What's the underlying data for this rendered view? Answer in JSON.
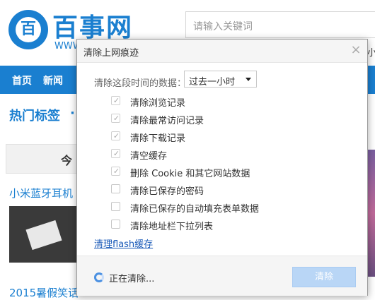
{
  "background": {
    "logo_mark": "百",
    "logo_text": "百事网",
    "logo_www": "WWW",
    "search_placeholder": "请输入关键词",
    "right_fragment": "小",
    "nav": [
      "首页",
      "新闻"
    ],
    "hot_tags": "热门标签",
    "hot_dot": "·",
    "today": "今",
    "article_title": "小米蓝牙耳机",
    "bottom_title": "2015暑假笑话"
  },
  "dialog": {
    "title": "清除上网痕迹",
    "close_icon": "×",
    "time_label": "清除这段时间的数据：",
    "time_value": "过去一小时",
    "options": [
      {
        "label": "清除浏览记录",
        "checked": true
      },
      {
        "label": "清除最常访问记录",
        "checked": true
      },
      {
        "label": "清除下载记录",
        "checked": true
      },
      {
        "label": "清空缓存",
        "checked": true
      },
      {
        "label": "删除 Cookie 和其它网站数据",
        "checked": true
      },
      {
        "label": "清除已保存的密码",
        "checked": false
      },
      {
        "label": "清除已保存的自动填充表单数据",
        "checked": false
      },
      {
        "label": "清除地址栏下拉列表",
        "checked": false
      }
    ],
    "flash_link": "清理flash缓存",
    "status": "正在清除...",
    "clear_button": "清除",
    "checkmark": "✓"
  }
}
